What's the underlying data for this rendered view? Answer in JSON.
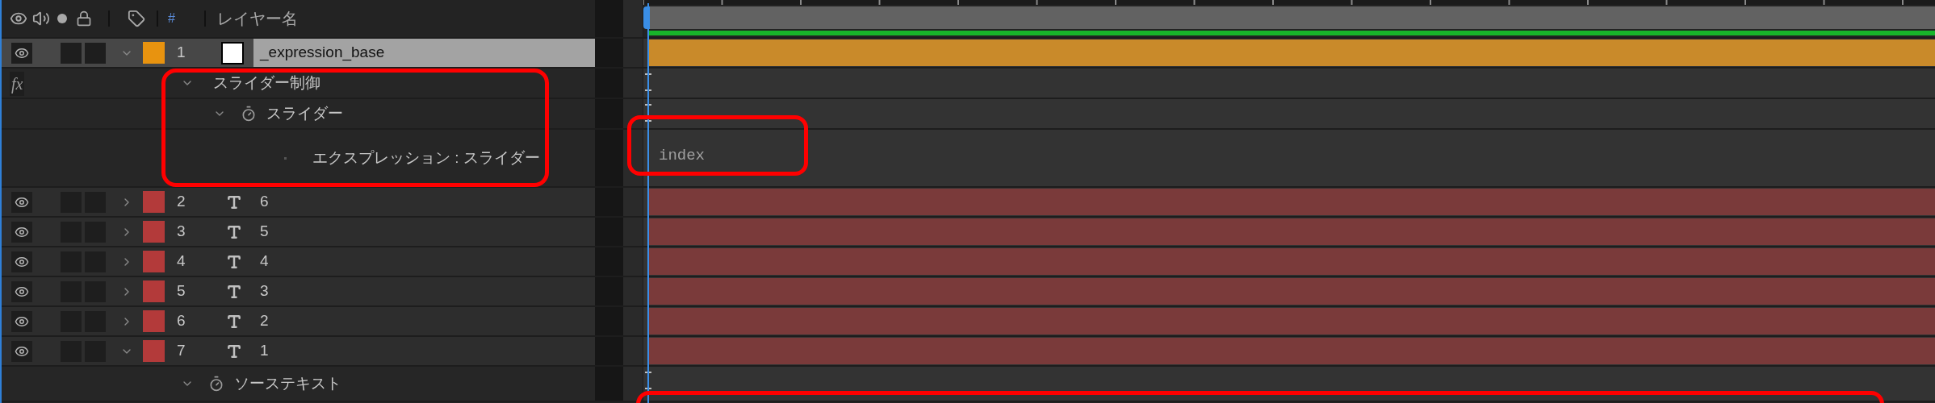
{
  "header": {
    "number_label": "#",
    "name_label": "レイヤー名"
  },
  "layers": [
    {
      "number": "1",
      "name": "_expression_base",
      "kind": "solid",
      "expanded": true,
      "selected": true,
      "visible": true,
      "effects_switch": "fx",
      "effects_enabled": true,
      "children": [
        {
          "kind": "effect",
          "label": "スライダー制御",
          "expanded": true,
          "children": [
            {
              "kind": "property",
              "label": "スライダー",
              "expanded": true,
              "children": [
                {
                  "kind": "expression",
                  "label": "エクスプレッション : スライダー",
                  "expression": "index"
                }
              ]
            }
          ]
        }
      ]
    },
    {
      "number": "2",
      "name": "6",
      "kind": "text",
      "expanded": false,
      "selected": false,
      "visible": true
    },
    {
      "number": "3",
      "name": "5",
      "kind": "text",
      "expanded": false,
      "selected": false,
      "visible": true
    },
    {
      "number": "4",
      "name": "4",
      "kind": "text",
      "expanded": false,
      "selected": false,
      "visible": true
    },
    {
      "number": "5",
      "name": "3",
      "kind": "text",
      "expanded": false,
      "selected": false,
      "visible": true
    },
    {
      "number": "6",
      "name": "2",
      "kind": "text",
      "expanded": false,
      "selected": false,
      "visible": true
    },
    {
      "number": "7",
      "name": "1",
      "kind": "text",
      "expanded": true,
      "selected": false,
      "visible": true,
      "children": [
        {
          "kind": "property",
          "label": "ソーステキスト",
          "expanded": true
        }
      ]
    }
  ]
}
